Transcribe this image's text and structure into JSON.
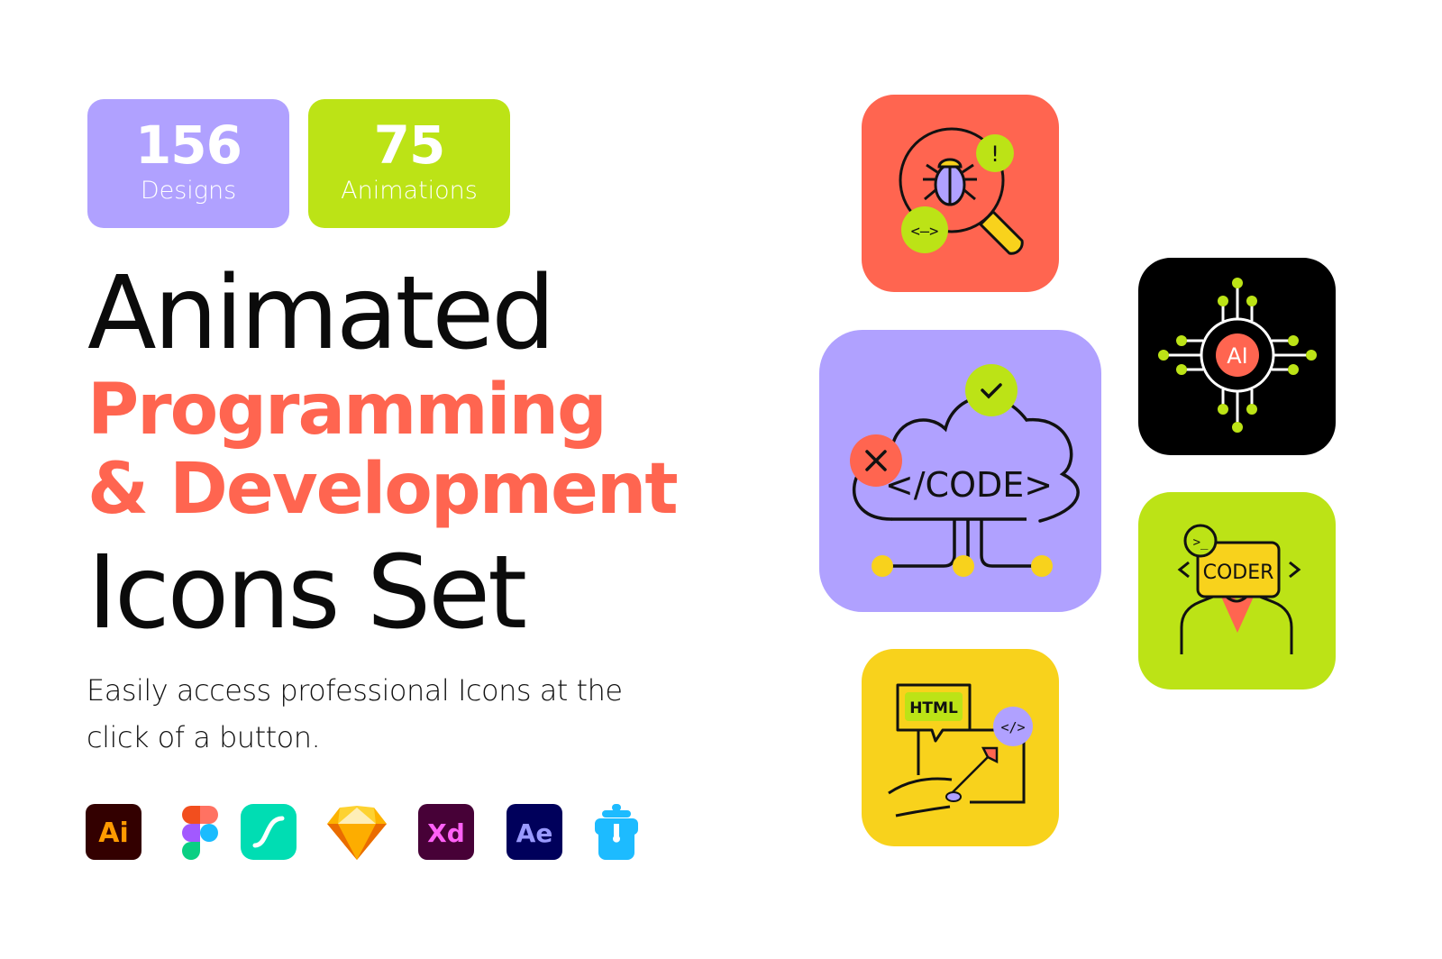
{
  "stats": [
    {
      "value": "156",
      "label": "Designs",
      "color": "#b0a1ff"
    },
    {
      "value": "75",
      "label": "Animations",
      "color": "#bce316"
    }
  ],
  "headline": {
    "line1": "Animated",
    "line2": "Programming",
    "line3": "& Development",
    "line4": "Icons Set",
    "accent_color": "#ff6550"
  },
  "description": "Easily access professional Icons at the click of a button.",
  "tools": [
    {
      "name": "Adobe Illustrator",
      "glyph": "Ai",
      "bg": "#330000",
      "fg": "#ff9a00"
    },
    {
      "name": "Figma",
      "glyph": ""
    },
    {
      "name": "LottieFiles",
      "glyph": "",
      "bg": "#00ddb3"
    },
    {
      "name": "Sketch",
      "glyph": ""
    },
    {
      "name": "Adobe XD",
      "glyph": "Xd",
      "bg": "#470137",
      "fg": "#ff61f6"
    },
    {
      "name": "Adobe After Effects",
      "glyph": "Ae",
      "bg": "#00005b",
      "fg": "#9999ff"
    },
    {
      "name": "Iconjar",
      "glyph": ""
    }
  ],
  "tiles": {
    "bug_search": {
      "name": "bug-search",
      "bg": "#ff6550",
      "badge_top": "!",
      "badge_bottom": "<–>"
    },
    "ai_chip": {
      "name": "ai-chip",
      "bg": "#000000",
      "label": "AI"
    },
    "cloud_code": {
      "name": "cloud-code",
      "bg": "#b0a1ff",
      "label": "</CODE>"
    },
    "coder": {
      "name": "coder",
      "bg": "#bce316",
      "label": "CODER",
      "prompt": ">_"
    },
    "html_tool": {
      "name": "html-tool",
      "bg": "#f8d21c",
      "label": "HTML",
      "badge": "</>"
    }
  }
}
